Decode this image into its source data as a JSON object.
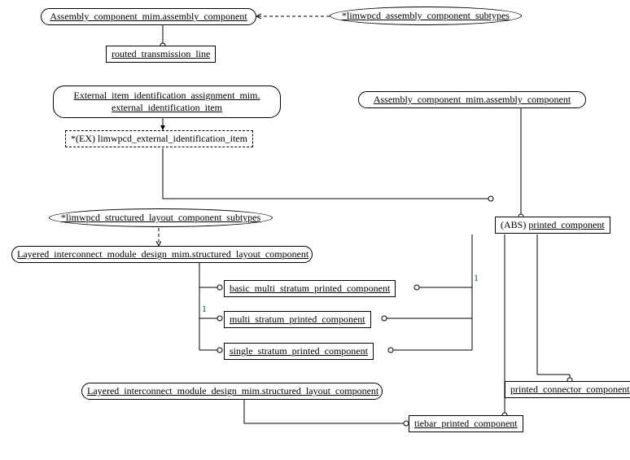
{
  "nodes": {
    "n1": "Assembly_component_mim.assembly_component",
    "n2": "*limwpcd_assembly_component_subtypes",
    "n3": "routed_transmission_line",
    "n4_l1": "External_item_identification_assignment_mim.",
    "n4_l2": "external_identification_item",
    "n5": "Assembly_component_mim.assembly_component",
    "n6": "*(EX) limwpcd_external_identification_item",
    "n7": "*limwpcd_structured_layout_component_subtypes",
    "n8": "(ABS) printed_component",
    "n9": "Layered_interconnect_module_design_mim.structured_layout_component",
    "n10": "basic_multi_stratum_printed_component",
    "n11": "multi_stratum_printed_component",
    "n12": "single_stratum_printed_component",
    "n13": "Layered_interconnect_module_design_mim.structured_layout_component",
    "n14": "tiebar_printed_component",
    "n15": "printed_connector_component"
  },
  "labels": {
    "one_a": "1",
    "one_b": "1"
  }
}
